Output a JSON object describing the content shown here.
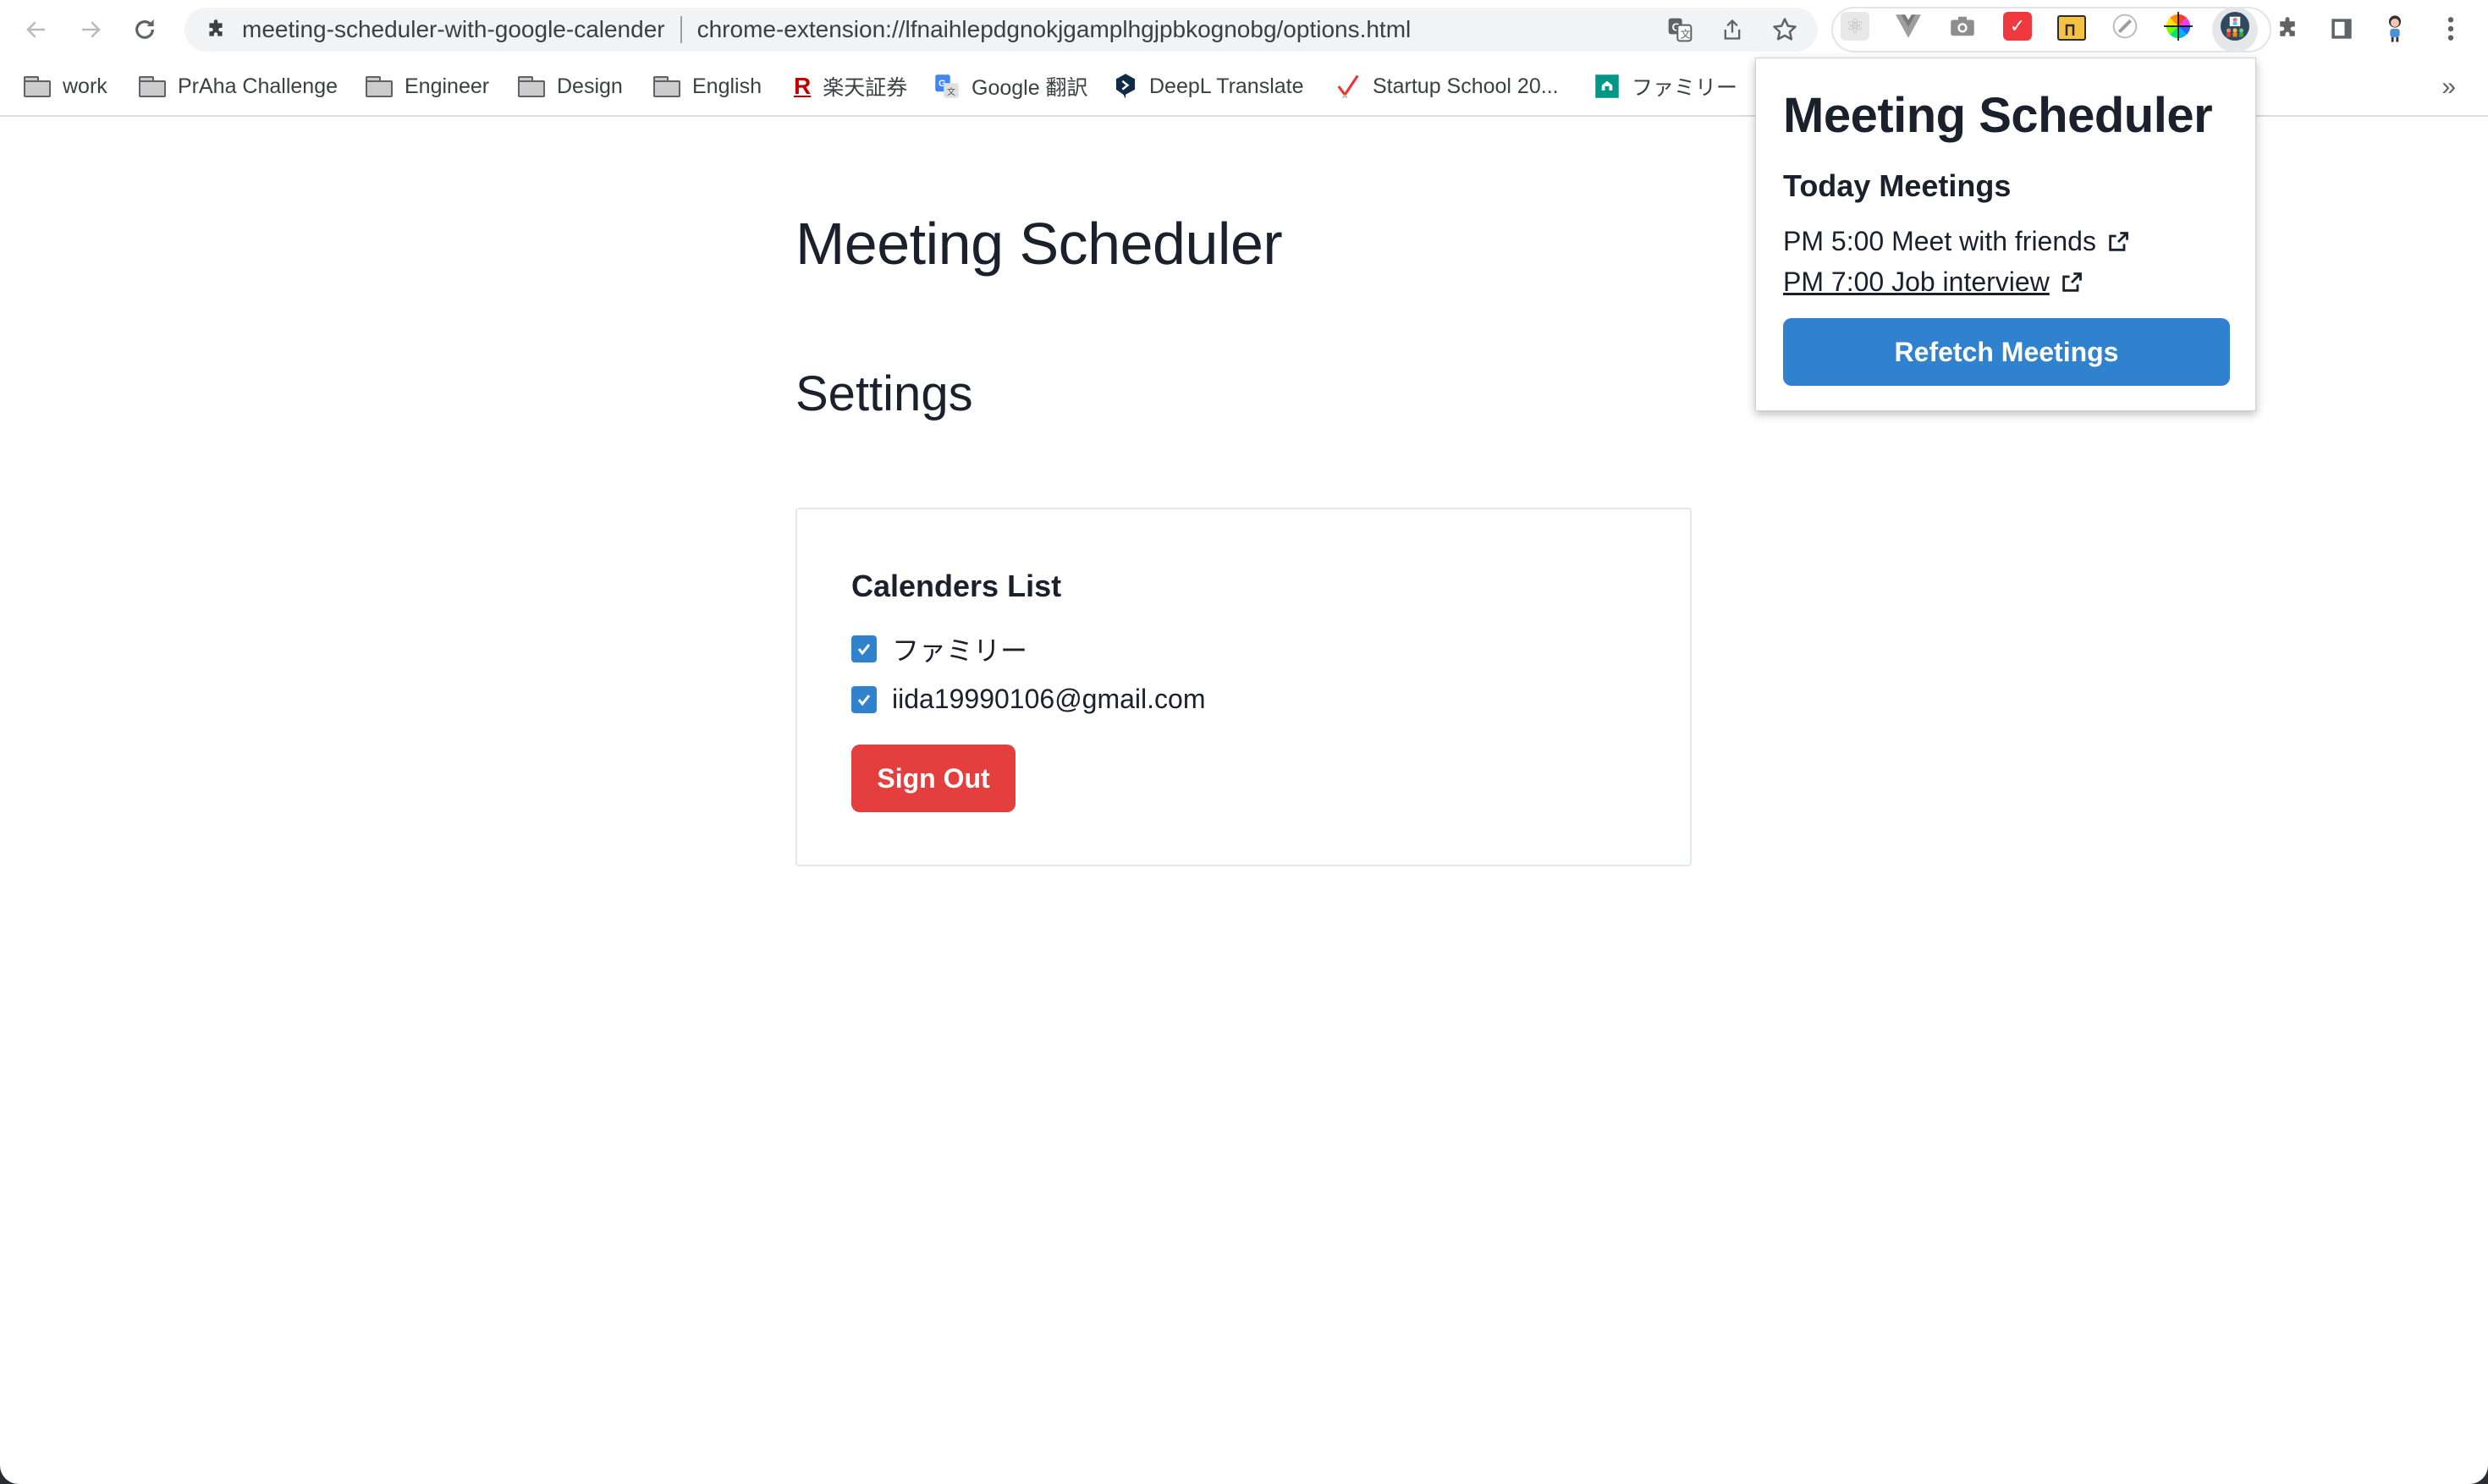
{
  "browser": {
    "tab_title": "meeting-scheduler-with-google-calender",
    "url": "chrome-extension://lfnaihlepdgnokjgamplhgjpbkognobg/options.html",
    "nav": {
      "back_icon": "arrow-left-icon",
      "forward_icon": "arrow-right-icon",
      "reload_icon": "reload-icon"
    },
    "omnibox_actions": [
      "translate-icon",
      "share-icon",
      "bookmark-star-icon"
    ],
    "extensions": [
      {
        "name": "react-devtools-icon",
        "glyph": "⚛"
      },
      {
        "name": "vue-devtools-icon",
        "glyph": "V"
      },
      {
        "name": "screenshot-camera-icon",
        "glyph": "📷"
      },
      {
        "name": "clock-red-icon",
        "glyph": "✓"
      },
      {
        "name": "yellow-window-icon",
        "glyph": ""
      },
      {
        "name": "ruler-icon",
        "glyph": "⁄"
      },
      {
        "name": "color-wheel-icon",
        "glyph": ""
      },
      {
        "name": "meeting-scheduler-extension-icon",
        "glyph": "👥"
      }
    ],
    "right_icons": [
      "extensions-puzzle-icon",
      "side-panel-icon",
      "profile-avatar-icon",
      "menu-kebab-icon"
    ]
  },
  "bookmarks": [
    {
      "label": "work",
      "icon": "folder-icon"
    },
    {
      "label": "PrAha Challenge",
      "icon": "folder-icon"
    },
    {
      "label": "Engineer",
      "icon": "folder-icon"
    },
    {
      "label": "Design",
      "icon": "folder-icon"
    },
    {
      "label": "English",
      "icon": "folder-icon"
    },
    {
      "label": "楽天証券",
      "icon": "rakuten-icon"
    },
    {
      "label": "Google 翻訳",
      "icon": "google-translate-icon"
    },
    {
      "label": "DeepL Translate",
      "icon": "deepl-icon"
    },
    {
      "label": "Startup School 20...",
      "icon": "startup-school-icon"
    },
    {
      "label": "ファミリー",
      "icon": "family-calendar-icon"
    }
  ],
  "bookmarks_overflow": "»",
  "page": {
    "title": "Meeting Scheduler",
    "subtitle": "Settings",
    "calendars_title": "Calenders List",
    "calendars": [
      {
        "label": "ファミリー",
        "checked": true
      },
      {
        "label": "iida19990106@gmail.com",
        "checked": true
      }
    ],
    "sign_out_label": "Sign Out"
  },
  "popup": {
    "title": "Meeting Scheduler",
    "subtitle": "Today Meetings",
    "meetings": [
      {
        "text": "PM 5:00 Meet with friends",
        "hovered": false
      },
      {
        "text": "PM 7:00 Job interview",
        "hovered": true
      }
    ],
    "refetch_label": "Refetch Meetings"
  },
  "colors": {
    "primary": "#3182ce",
    "danger": "#e53e3e",
    "text": "#1a202c",
    "border": "#e2e8f0"
  }
}
